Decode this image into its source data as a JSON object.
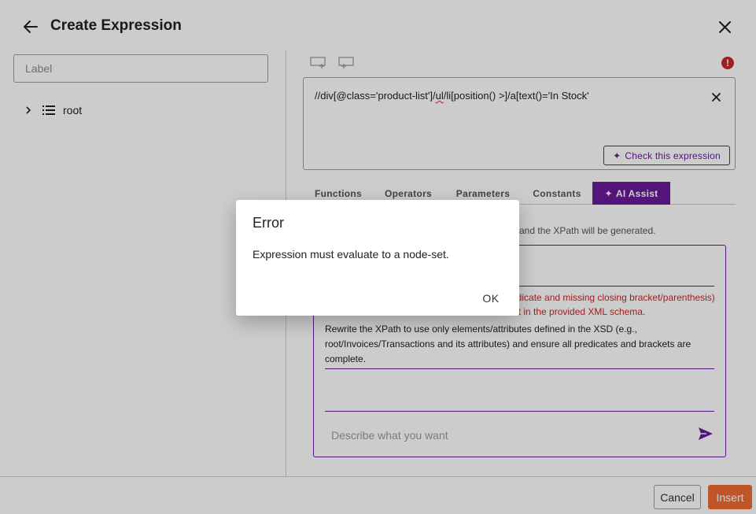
{
  "header": {
    "title": "Create Expression"
  },
  "left_panel": {
    "label_placeholder": "Label",
    "tree_root_label": "root"
  },
  "editor": {
    "expr_part1": "//div[@class='product-list']/",
    "expr_misspelled": "ul",
    "expr_part2": "/li[position() >]/a[text()='In Stock'",
    "check_button": "Check this expression",
    "error_indicator": "!"
  },
  "tabs": [
    "Functions",
    "Operators",
    "Parameters",
    "Constants",
    "AI Assist"
  ],
  "ai_assist": {
    "hint_text": "and the XPath will be generated.",
    "error_line1": "edicate and missing closing bracket/parenthesis)",
    "error_line2": "ist in the provided XML schema.",
    "suggestion": "Rewrite the XPath to use only elements/attributes defined in the XSD (e.g., root/Invoices/Transactions and its attributes) and ensure all predicates and brackets are complete.",
    "input_placeholder": "Describe what you want"
  },
  "footer": {
    "cancel_label": "Cancel",
    "insert_label": "Insert"
  },
  "dialog": {
    "title": "Error",
    "message": "Expression must evaluate to a node-set.",
    "ok_label": "OK"
  },
  "colors": {
    "accent": "#6a1b9a",
    "insert": "#ef6c34",
    "error": "#c62828"
  }
}
